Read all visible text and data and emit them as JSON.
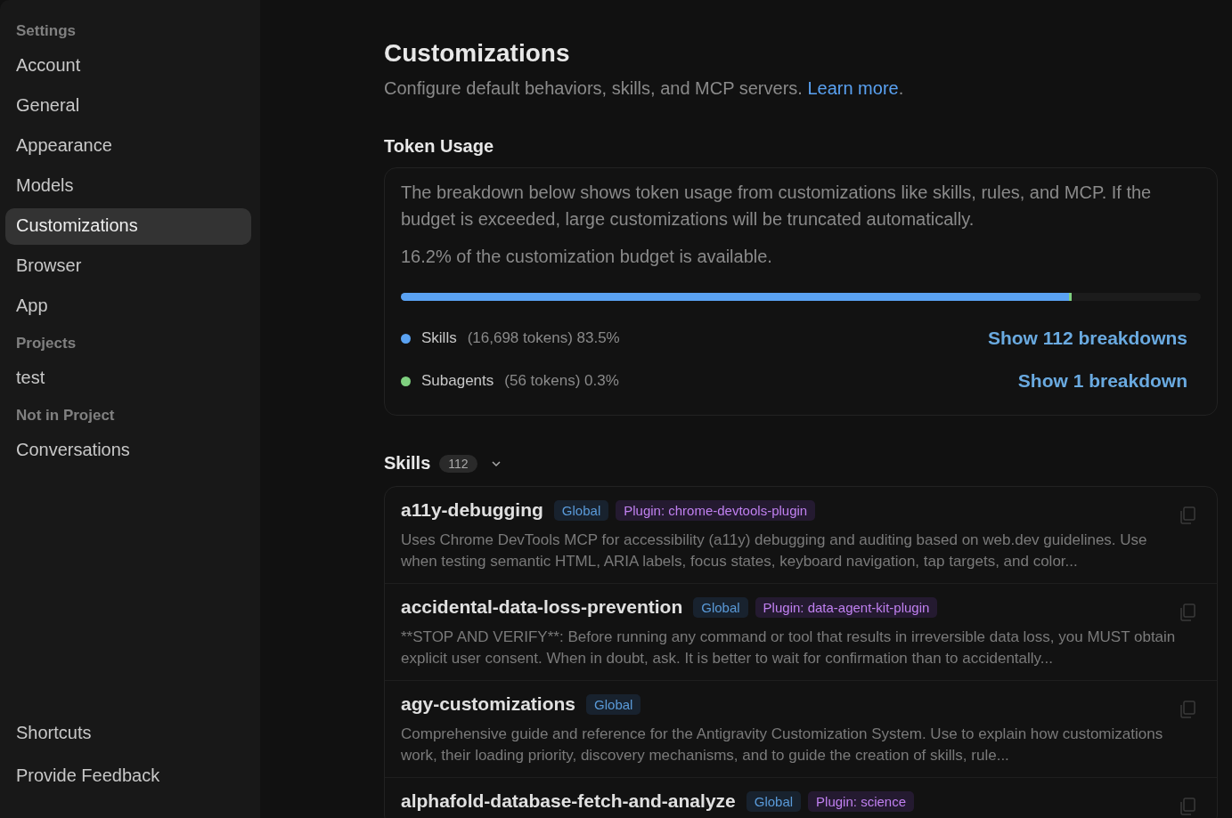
{
  "sidebar": {
    "groups": [
      {
        "heading": "Settings",
        "items": [
          {
            "label": "Account",
            "selected": false
          },
          {
            "label": "General",
            "selected": false
          },
          {
            "label": "Appearance",
            "selected": false
          },
          {
            "label": "Models",
            "selected": false
          },
          {
            "label": "Customizations",
            "selected": true
          },
          {
            "label": "Browser",
            "selected": false
          },
          {
            "label": "App",
            "selected": false
          }
        ]
      },
      {
        "heading": "Projects",
        "items": [
          {
            "label": "test",
            "selected": false
          }
        ]
      },
      {
        "heading": "Not in Project",
        "items": [
          {
            "label": "Conversations",
            "selected": false
          }
        ]
      }
    ],
    "footer_items": [
      "Shortcuts",
      "Provide Feedback"
    ]
  },
  "page": {
    "title": "Customizations",
    "subtitle": "Configure default behaviors, skills, and MCP servers.",
    "link": "Learn more",
    "link_end": "."
  },
  "token_usage": {
    "heading": "Token Usage",
    "description": "The breakdown below shows token usage from customizations like skills, rules, and MCP. If the budget is exceeded, large customizations will be truncated automatically.",
    "availability": "16.2% of the customization budget is available.",
    "segments": [
      {
        "name": "Skills",
        "detail": "(16,698 tokens) 83.5%",
        "level": 0.835,
        "color": "#5aa2f2",
        "action": "Show 112 breakdowns"
      },
      {
        "name": "Subagents",
        "detail": "(56 tokens) 0.3%",
        "level": 0.003,
        "color": "#7fd07f",
        "action": "Show 1 breakdown"
      }
    ]
  },
  "skills": {
    "heading": "Skills",
    "count": "112",
    "expanded": true,
    "items": [
      {
        "name": "a11y-debugging",
        "tags": [
          {
            "kind": "scope",
            "label": "Global"
          },
          {
            "kind": "plugin",
            "label": "Plugin: chrome-devtools-plugin"
          }
        ],
        "description": "Uses Chrome DevTools MCP for accessibility (a11y) debugging and auditing based on web.dev guidelines. Use when testing semantic HTML, ARIA labels, focus states, keyboard navigation, tap targets, and color..."
      },
      {
        "name": "accidental-data-loss-prevention",
        "tags": [
          {
            "kind": "scope",
            "label": "Global"
          },
          {
            "kind": "plugin",
            "label": "Plugin: data-agent-kit-plugin"
          }
        ],
        "description": "**STOP AND VERIFY**: Before running any command or tool that results in irreversible data loss, you MUST obtain explicit user consent. When in doubt, ask. It is better to wait for confirmation than to accidentally..."
      },
      {
        "name": "agy-customizations",
        "tags": [
          {
            "kind": "scope",
            "label": "Global"
          }
        ],
        "description": "Comprehensive guide and reference for the Antigravity Customization System. Use to explain how customizations work, their loading priority, discovery mechanisms, and to guide the creation of skills, rule..."
      },
      {
        "name": "alphafold-database-fetch-and-analyze",
        "tags": [
          {
            "kind": "scope",
            "label": "Global"
          },
          {
            "kind": "plugin",
            "label": "Plugin: science"
          }
        ]
      }
    ]
  }
}
